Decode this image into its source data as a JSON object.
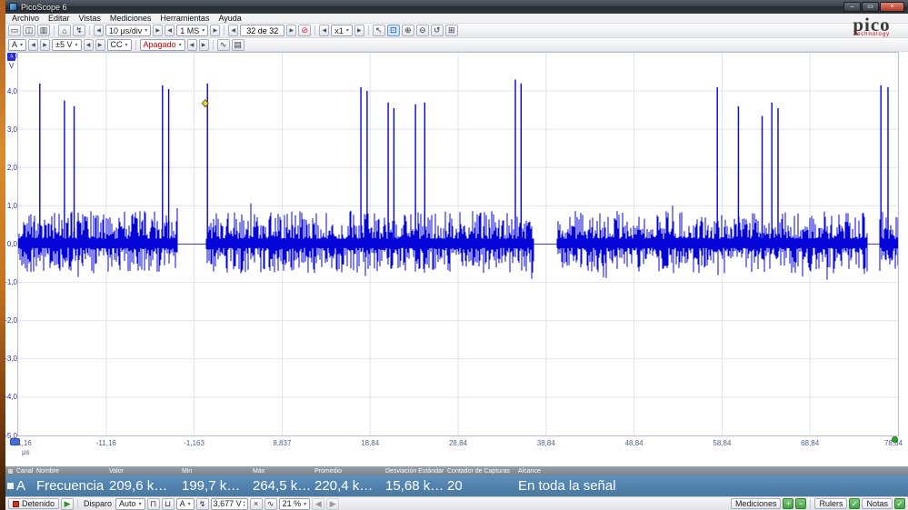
{
  "window": {
    "title": "PicoScope 6",
    "minimize_glyph": "–",
    "maximize_glyph": "▭",
    "close_glyph": "×"
  },
  "menu": {
    "items": [
      "Archivo",
      "Editar",
      "Vistas",
      "Mediciones",
      "Herramientas",
      "Ayuda"
    ]
  },
  "icons": {
    "caret": "▾",
    "left": "◀",
    "right": "▶",
    "up": "▴",
    "down": "▾",
    "view_single": "▭",
    "view_multi": "◫",
    "view_chart": "▥",
    "home": "⌂",
    "auto_setup": "↯",
    "no_capture": "⊘",
    "pointer": "↖",
    "zoom_box": "⊡",
    "zoom_in": "⊕",
    "zoom_out": "⊖",
    "zoom_undo": "↺",
    "pan": "⊞",
    "wave": "∿",
    "grid": "▤",
    "edge_rise": "⊓",
    "edge_fall": "⊔",
    "close_small": "×",
    "play": "▶",
    "plus": "+",
    "minus": "−",
    "check": "✓"
  },
  "toolbar_capture": {
    "timebase": "10 µs/div",
    "samples": "1 MS",
    "captures": "32 de 32",
    "zoom_factor": "x1"
  },
  "toolbar_channels": {
    "channel": "A",
    "range": "±5 V",
    "coupling": "CC",
    "channel_b_state": "Apagado"
  },
  "logo": {
    "brand": "pico",
    "sub": "Technology"
  },
  "scope": {
    "channel_tag": "A",
    "y_unit": "V",
    "x_unit": "µs",
    "y_labels": [
      "5,0",
      "4,0",
      "3,0",
      "2,0",
      "1,0",
      "0,0",
      "-1,0",
      "-2,0",
      "-3,0",
      "-4,0",
      "-5,0"
    ],
    "x_labels": [
      "-21,16",
      "-11,16",
      "-1,163",
      "8,837",
      "18,84",
      "28,84",
      "38,84",
      "48,84",
      "58,84",
      "68,84",
      "78,84"
    ]
  },
  "waveform": {
    "type": "oscilloscope-trace",
    "color": "#0404d8",
    "grid_color": "#e2e3ee",
    "x_range_us": [
      -21.16,
      78.84
    ],
    "y_range_v": [
      -5,
      5
    ],
    "noise_regions_us": [
      [
        -21.16,
        -3.0
      ],
      [
        0.22,
        37.5
      ],
      [
        40.0,
        75.4
      ],
      [
        76.7,
        78.84
      ]
    ],
    "noise_amp_v": 0.85,
    "spikes_us_v": [
      [
        -18.7,
        4.2
      ],
      [
        -15.9,
        3.75
      ],
      [
        -14.8,
        3.6
      ],
      [
        -4.75,
        4.15
      ],
      [
        -4.05,
        4.05
      ],
      [
        0.35,
        4.2
      ],
      [
        17.8,
        4.1
      ],
      [
        18.5,
        4.0
      ],
      [
        20.9,
        3.7
      ],
      [
        21.55,
        3.55
      ],
      [
        24.0,
        3.65
      ],
      [
        25.05,
        3.7
      ],
      [
        35.35,
        4.3
      ],
      [
        36.0,
        4.2
      ],
      [
        58.3,
        4.1
      ],
      [
        60.7,
        3.6
      ],
      [
        63.4,
        3.35
      ],
      [
        64.5,
        3.7
      ],
      [
        65.2,
        3.55
      ],
      [
        76.9,
        4.15
      ],
      [
        77.7,
        4.1
      ]
    ],
    "marker": {
      "x_us": 0.1,
      "y_v": 3.677,
      "color": "#f0d040"
    },
    "trigger_dot_color": "#2fa52f"
  },
  "measurements": {
    "headers": [
      "Canal",
      "Nombre",
      "Valor",
      "Min",
      "Máx",
      "Promedio",
      "Desviación Estándar",
      "Contador de Capturas",
      "Alcance"
    ],
    "row": {
      "canal": "A",
      "nombre": "Frecuencia",
      "valor": "209,6 k…",
      "min": "199,7 k…",
      "max": "264,5 k…",
      "promedio": "220,4 k…",
      "desviacion": "15,68 k…",
      "contador": "20",
      "alcance": "En toda la señal"
    }
  },
  "status_bar": {
    "run_state": "Detenido",
    "trigger_label": "Disparo",
    "trigger_mode": "Auto",
    "trigger_channel": "A",
    "trigger_level": "3,677 V",
    "pretrigger": "21 %",
    "mediciones_label": "Mediciones",
    "rulers_label": "Rulers",
    "notas_label": "Notas"
  }
}
